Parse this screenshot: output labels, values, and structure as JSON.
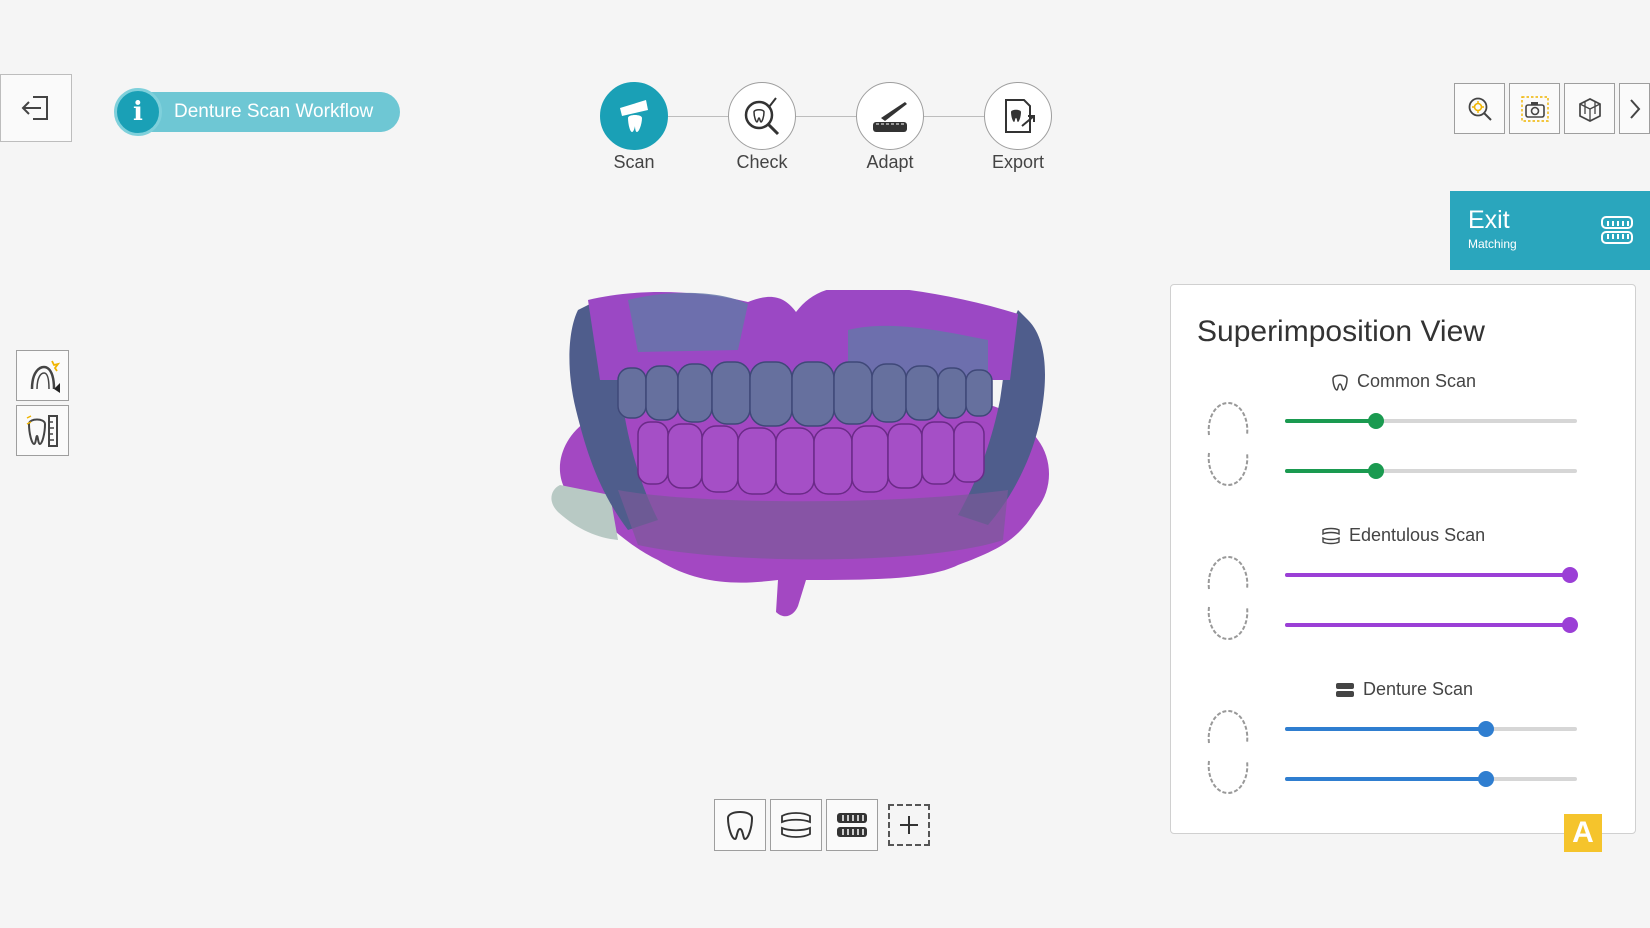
{
  "header": {
    "workflow_label": "Denture Scan Workflow",
    "info_icon_glyph": "i"
  },
  "steps": [
    {
      "label": "Scan",
      "active": true
    },
    {
      "label": "Check",
      "active": false
    },
    {
      "label": "Adapt",
      "active": false
    },
    {
      "label": "Export",
      "active": false
    }
  ],
  "exit_button": {
    "title": "Exit",
    "subtitle": "Matching"
  },
  "panel": {
    "title": "Superimposition View",
    "groups": [
      {
        "name": "Common Scan",
        "color": "#1a9a50",
        "upper": 0.31,
        "lower": 0.31
      },
      {
        "name": "Edentulous Scan",
        "color": "#9b3fd6",
        "upper": 0.975,
        "lower": 0.975
      },
      {
        "name": "Denture Scan",
        "color": "#2f7ed0",
        "upper": 0.69,
        "lower": 0.69
      }
    ]
  },
  "badge": {
    "letter": "A"
  },
  "colors": {
    "accent": "#1aa0b6",
    "accent_light": "#6ec7d4",
    "scan_purple": "#a348c2",
    "scan_blue": "#5a6ea0"
  }
}
